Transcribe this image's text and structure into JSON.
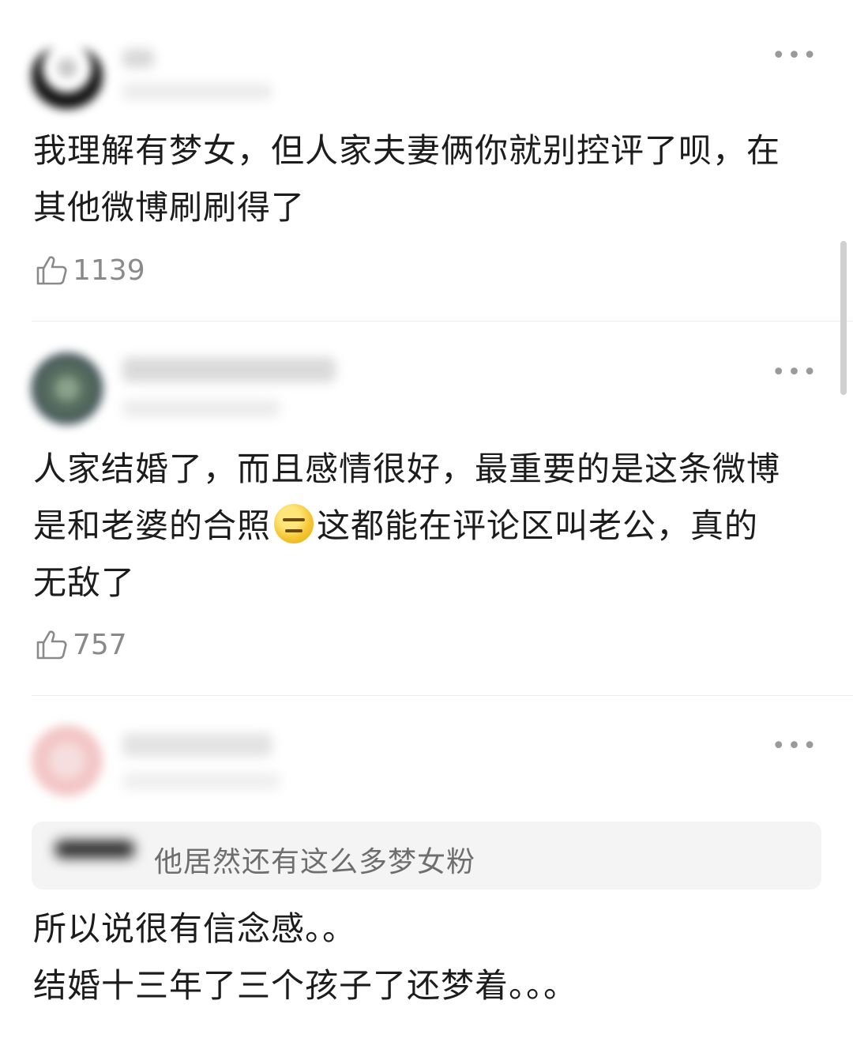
{
  "comments": [
    {
      "text": "我理解有梦女，但人家夫妻俩你就别控评了呗，在\n其他微博刷刷得了",
      "likes": "1139"
    },
    {
      "text_part1": "人家结婚了，而且感情很好，最重要的是这条微博\n是和老婆的合照",
      "text_part2": "这都能在评论区叫老公，真的\n无敌了",
      "likes": "757"
    },
    {
      "quote": "他居然还有这么多梦女粉",
      "text": "所以说很有信念感。。\n结婚十三年了三个孩子了还梦着。。。"
    }
  ],
  "more_glyph": "•••",
  "icons": {
    "like": "thumbs-up-icon",
    "more": "more-options-icon",
    "emoji": "expressionless-face-emoji"
  }
}
